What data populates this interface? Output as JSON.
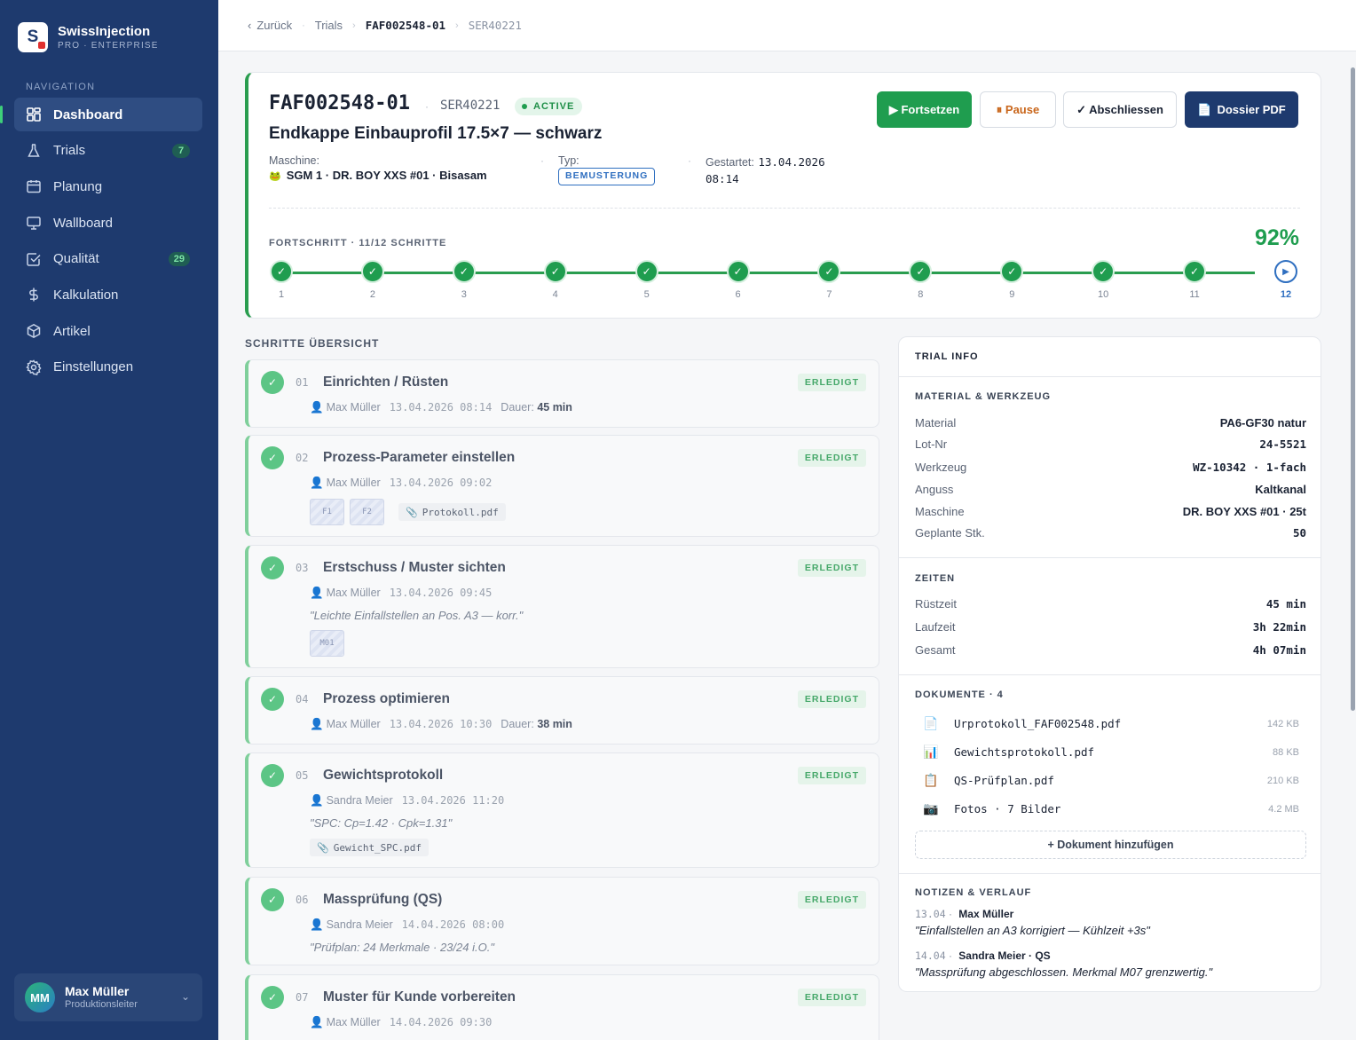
{
  "brand": {
    "logo_letter": "S",
    "name": "SwissInjection",
    "tagline": "PRO · ENTERPRISE"
  },
  "nav": {
    "title": "NAVIGATION",
    "items": [
      {
        "label": "Dashboard",
        "icon": "grid-icon",
        "active": true
      },
      {
        "label": "Trials",
        "icon": "flask-icon",
        "badge": "7"
      },
      {
        "label": "Planung",
        "icon": "calendar-icon"
      },
      {
        "label": "Wallboard",
        "icon": "monitor-icon"
      },
      {
        "label": "Qualität",
        "icon": "check-square-icon",
        "badge": "29"
      },
      {
        "label": "Kalkulation",
        "icon": "dollar-icon"
      },
      {
        "label": "Artikel",
        "icon": "box-icon"
      },
      {
        "label": "Einstellungen",
        "icon": "gear-icon"
      }
    ]
  },
  "user": {
    "initials": "MM",
    "name": "Max Müller",
    "role": "Produktionsleiter"
  },
  "breadcrumb": {
    "back": "Zurück",
    "trials": "Trials",
    "order": "FAF002548-01",
    "serial": "SER40221"
  },
  "header": {
    "trial_id": "FAF002548-01",
    "serial": "SER40221",
    "status": "ACTIVE",
    "title": "Endkappe Einbauprofil 17.5×7 — schwarz",
    "machine_label": "Maschine:",
    "machine_value": "SGM 1 · DR. BOY XXS #01 · Bisasam",
    "type_label": "Typ:",
    "type_value": "BEMUSTERUNG",
    "started_label": "Gestartet:",
    "started_date": "13.04.2026",
    "started_time": "08:14",
    "buttons": {
      "continue": "▶ Fortsetzen",
      "pause": "⏸ Pause",
      "finish": "✓ Abschliessen",
      "pdf": "Dossier PDF"
    },
    "progress_label": "FORTSCHRITT · 11/12 SCHRITTE",
    "progress_pct": "92%",
    "progress_value": 0.92,
    "steps": [
      "1",
      "2",
      "3",
      "4",
      "5",
      "6",
      "7",
      "8",
      "9",
      "10",
      "11",
      "12"
    ],
    "completed_steps": 11
  },
  "steps_title": "SCHRITTE ÜBERSICHT",
  "steps": [
    {
      "num": "01",
      "title": "Einrichten / Rüsten",
      "status": "ERLEDIGT",
      "user": "Max Müller",
      "ts": "13.04.2026 08:14",
      "dur_label": "Dauer:",
      "dur": "45 min"
    },
    {
      "num": "02",
      "title": "Prozess-Parameter einstellen",
      "status": "ERLEDIGT",
      "user": "Max Müller",
      "ts": "13.04.2026 09:02",
      "thumbs": [
        "F1",
        "F2"
      ],
      "file": "Protokoll.pdf"
    },
    {
      "num": "03",
      "title": "Erstschuss / Muster sichten",
      "status": "ERLEDIGT",
      "user": "Max Müller",
      "ts": "13.04.2026 09:45",
      "note": "\"Leichte Einfallstellen an Pos. A3 — korr.\"",
      "thumbs": [
        "M01"
      ]
    },
    {
      "num": "04",
      "title": "Prozess optimieren",
      "status": "ERLEDIGT",
      "user": "Max Müller",
      "ts": "13.04.2026 10:30",
      "dur_label": "Dauer:",
      "dur": "38 min"
    },
    {
      "num": "05",
      "title": "Gewichtsprotokoll",
      "status": "ERLEDIGT",
      "user": "Sandra Meier",
      "ts": "13.04.2026 11:20",
      "note": "\"SPC: Cp=1.42 · Cpk=1.31\"",
      "file": "Gewicht_SPC.pdf"
    },
    {
      "num": "06",
      "title": "Massprüfung (QS)",
      "status": "ERLEDIGT",
      "user": "Sandra Meier",
      "ts": "14.04.2026 08:00",
      "note": "\"Prüfplan: 24 Merkmale · 23/24 i.O.\""
    },
    {
      "num": "07",
      "title": "Muster für Kunde vorbereiten",
      "status": "ERLEDIGT",
      "user": "Max Müller",
      "ts": "14.04.2026 09:30"
    }
  ],
  "info": {
    "title": "TRIAL INFO",
    "material_title": "MATERIAL & WERKZEUG",
    "material": [
      {
        "k": "Material",
        "v": "PA6-GF30 natur"
      },
      {
        "k": "Lot-Nr",
        "v": "24-5521"
      },
      {
        "k": "Werkzeug",
        "v": "WZ-10342 · 1-fach"
      },
      {
        "k": "Anguss",
        "v": "Kaltkanal"
      },
      {
        "k": "Maschine",
        "v": "DR. BOY XXS #01 · 25t"
      },
      {
        "k": "Geplante Stk.",
        "v": "50"
      }
    ],
    "times_title": "ZEITEN",
    "times": [
      {
        "k": "Rüstzeit",
        "v": "45 min"
      },
      {
        "k": "Laufzeit",
        "v": "3h 22min"
      },
      {
        "k": "Gesamt",
        "v": "4h 07min"
      }
    ],
    "docs_title": "DOKUMENTE · 4",
    "docs": [
      {
        "icon": "📄",
        "name": "Urprotokoll_FAF002548.pdf",
        "size": "142 KB"
      },
      {
        "icon": "📊",
        "name": "Gewichtsprotokoll.pdf",
        "size": "88 KB"
      },
      {
        "icon": "📋",
        "name": "QS-Prüfplan.pdf",
        "size": "210 KB"
      },
      {
        "icon": "📷",
        "name": "Fotos · 7 Bilder",
        "size": "4.2 MB"
      }
    ],
    "add_doc": "+ Dokument hinzufügen",
    "notes_title": "NOTIZEN & VERLAUF",
    "notes": [
      {
        "date": "13.04",
        "author": "Max Müller",
        "text": "\"Einfallstellen an A3 korrigiert — Kühlzeit +3s\""
      },
      {
        "date": "14.04",
        "author": "Sandra Meier · QS",
        "text": "\"Massprüfung abgeschlossen. Merkmal M07 grenzwertig.\""
      }
    ]
  },
  "colors": {
    "sidebar": "#1e3a6e",
    "accent_green": "#1f9d4f",
    "accent_blue": "#2f6fc0",
    "pause_orange": "#c9661b"
  }
}
